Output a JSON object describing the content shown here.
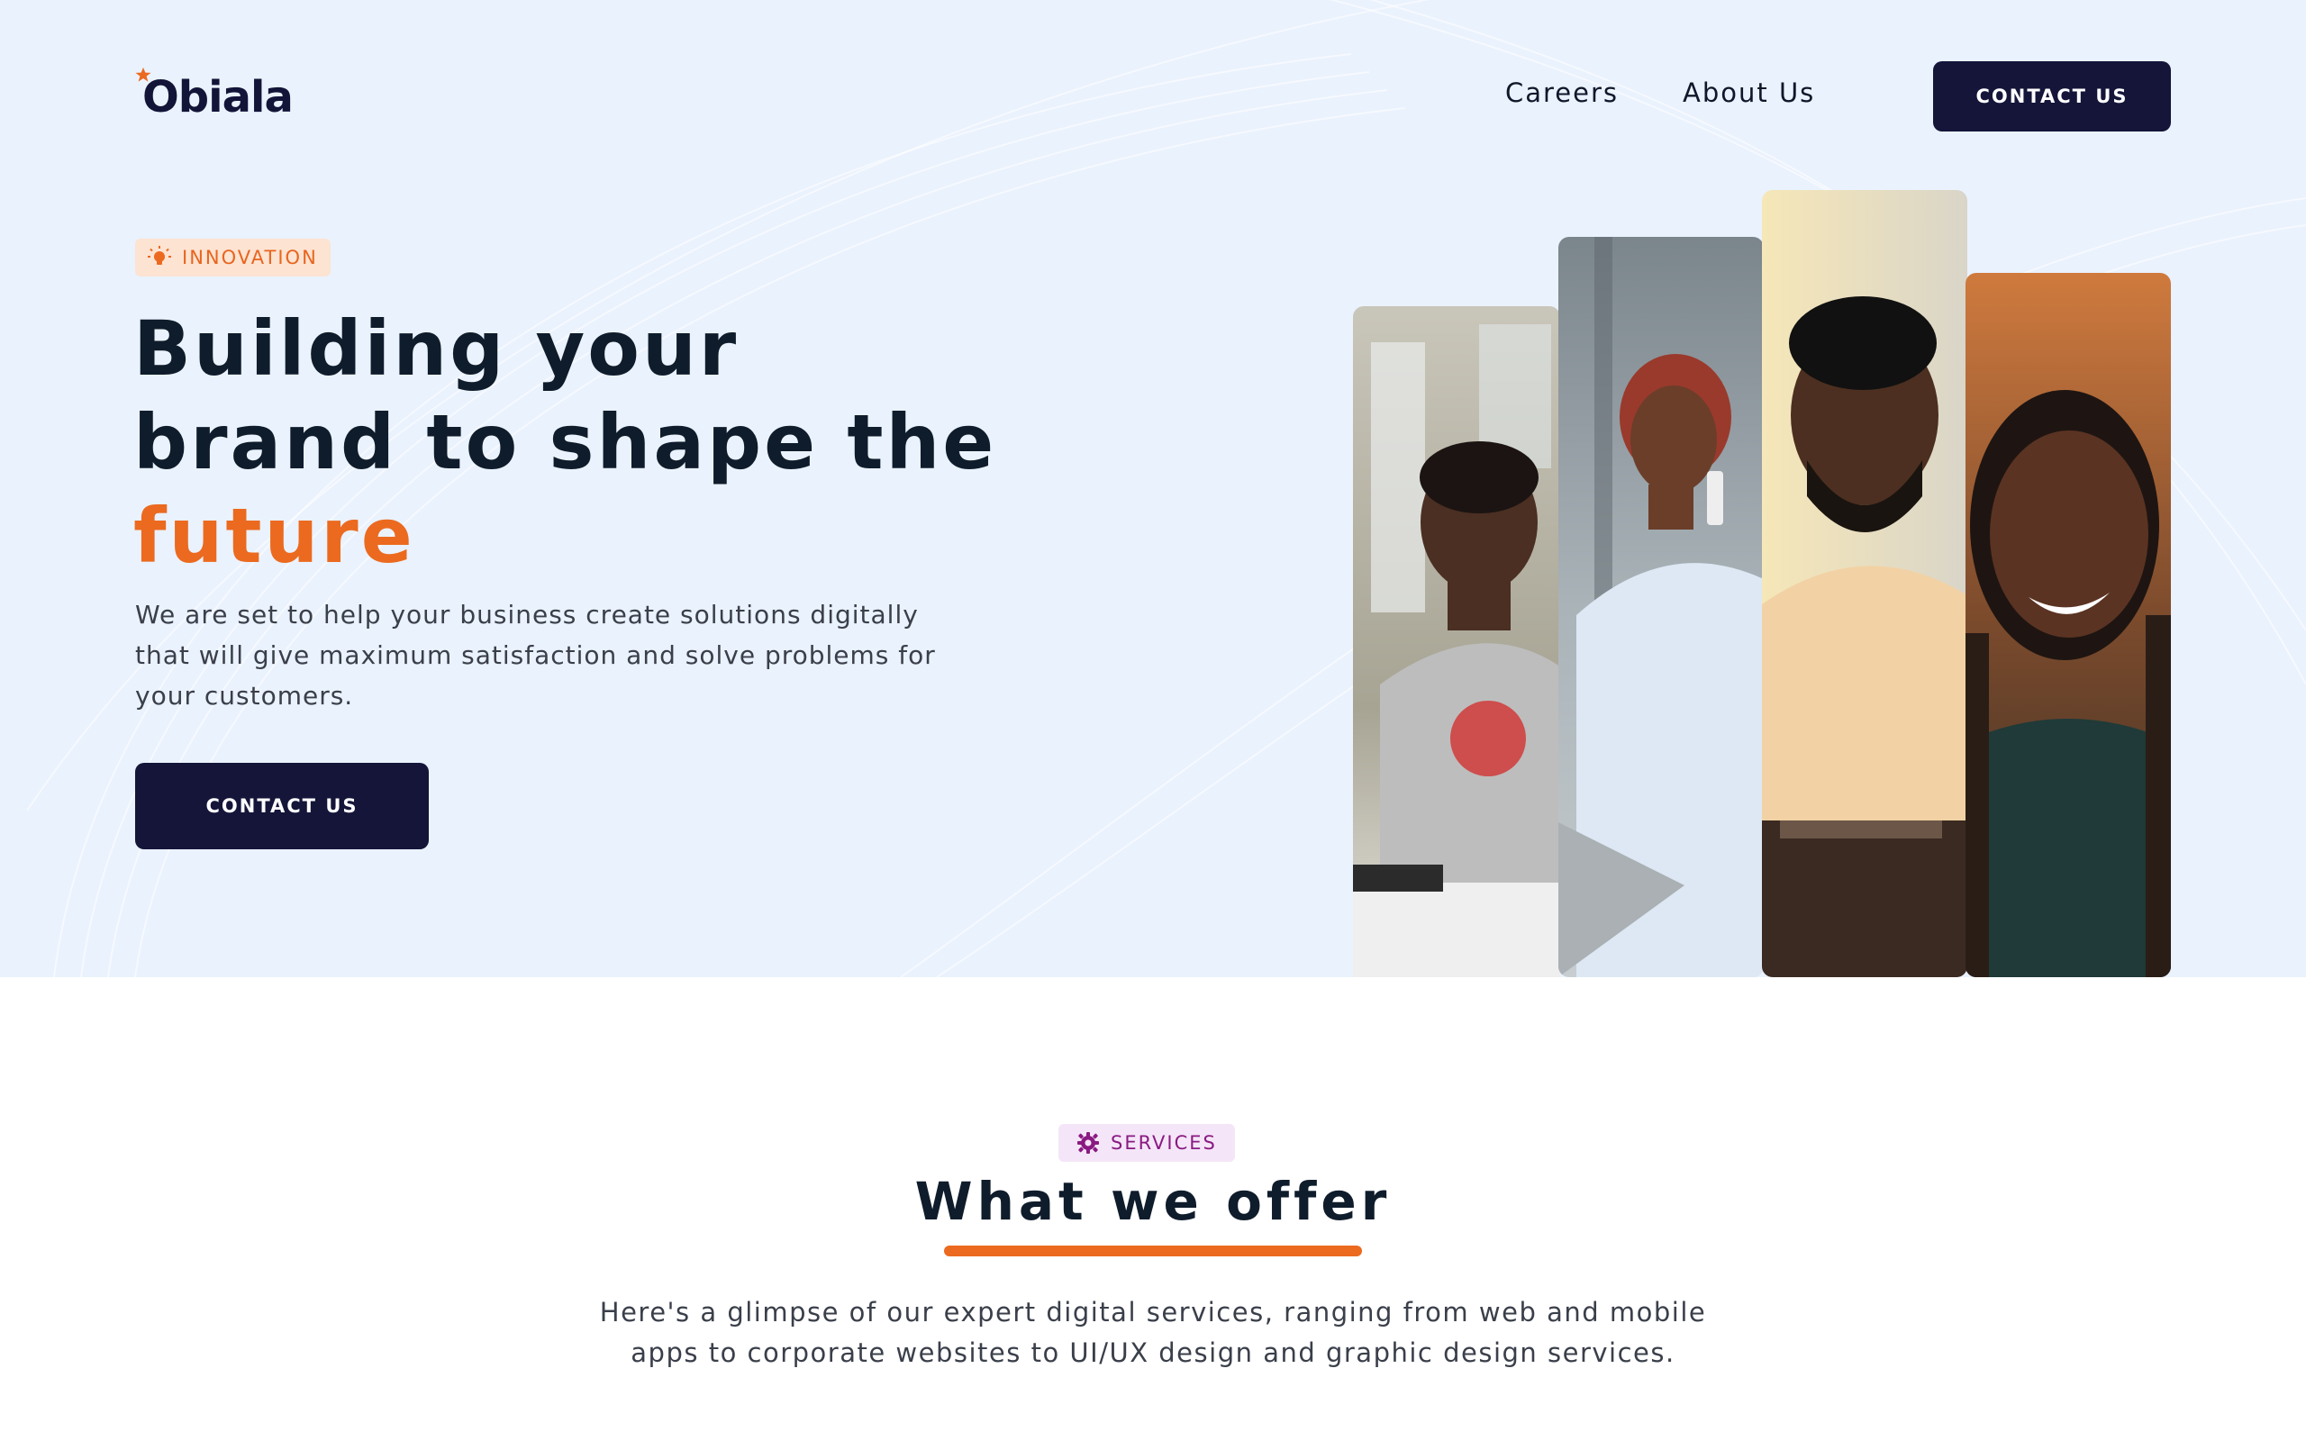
{
  "header": {
    "logo_text": "Obiala",
    "nav": [
      {
        "label": "Careers"
      },
      {
        "label": "About Us"
      }
    ],
    "cta_label": "CONTACT US"
  },
  "hero": {
    "tag_label": "INNOVATION",
    "headline_line1": "Building your",
    "headline_line2": "brand to shape the",
    "headline_accent": "future",
    "description": "We are set to help your business create solutions digitally that will give maximum satisfaction and solve problems for your customers.",
    "cta_label": "CONTACT US",
    "photos": [
      {
        "icon": "photo-man-laptop"
      },
      {
        "icon": "photo-woman-phone"
      },
      {
        "icon": "photo-man-smiling"
      },
      {
        "icon": "photo-woman-smiling"
      }
    ]
  },
  "services": {
    "tag_label": "SERVICES",
    "title": "What we offer",
    "description_line1": "Here's a glimpse of our expert digital services, ranging from web and mobile",
    "description_line2": "apps to corporate websites to UI/UX design and graphic design services."
  },
  "colors": {
    "hero_bg": "#eaf2fd",
    "dark_navy": "#141539",
    "accent_orange": "#eb6a1f",
    "services_tag_bg": "#f4e6f8",
    "services_tag_text": "#8a1a82"
  }
}
